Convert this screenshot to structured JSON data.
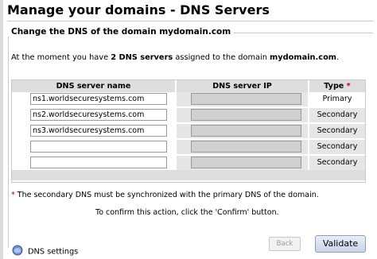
{
  "page": {
    "title": "Manage your domains - DNS Servers"
  },
  "section": {
    "title": "Change the DNS of the domain mydomain.com"
  },
  "intro": {
    "prefix": "At the moment you have ",
    "count_text": "2 DNS servers",
    "middle": " assigned to the domain ",
    "domain": "mydomain.com",
    "suffix": "."
  },
  "table": {
    "headers": {
      "name": "DNS server name",
      "ip": "DNS server IP",
      "type": "Type",
      "required_mark": "*"
    },
    "rows": [
      {
        "name": "ns1.worldsecuresystems.com",
        "ip": "",
        "type": "Primary"
      },
      {
        "name": "ns2.worldsecuresystems.com",
        "ip": "",
        "type": "Secondary"
      },
      {
        "name": "ns3.worldsecuresystems.com",
        "ip": "",
        "type": "Secondary"
      },
      {
        "name": "",
        "ip": "",
        "type": "Secondary"
      },
      {
        "name": "",
        "ip": "",
        "type": "Secondary"
      }
    ]
  },
  "note": {
    "star": "*",
    "text": " The secondary DNS must be synchronized with the primary DNS of the domain."
  },
  "confirm": {
    "text": "To confirm this action, click the 'Confirm' button."
  },
  "buttons": {
    "back": "Back",
    "validate": "Validate"
  },
  "footer": {
    "dns_settings_link": "DNS settings",
    "icon": "dns-settings-icon"
  },
  "colors": {
    "required": "#c00000",
    "header_bg": "#dedede",
    "disabled_field": "#d0d0d0"
  }
}
